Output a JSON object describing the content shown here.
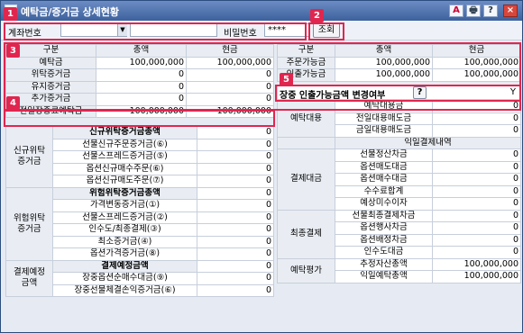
{
  "window": {
    "title": "예탁금/증거금 상세현황"
  },
  "title_buttons": [
    "A",
    "🖶",
    "?",
    "×"
  ],
  "toolbar": {
    "account_label": "계좌번호",
    "account_value": "",
    "account_name": "",
    "password_label": "비밀번호",
    "password_value": "****",
    "query_button": "조회"
  },
  "badges": [
    "1",
    "2",
    "3",
    "4",
    "5"
  ],
  "left_top": {
    "headers": [
      "구분",
      "총액",
      "현금"
    ],
    "rows": [
      {
        "label": "예탁금",
        "total": "100,000,000",
        "cash": "100,000,000"
      },
      {
        "label": "위탁증거금",
        "total": "0",
        "cash": "0"
      },
      {
        "label": "유지증거금",
        "total": "0",
        "cash": "0"
      },
      {
        "label": "추가증거금",
        "total": "0",
        "cash": "0"
      },
      {
        "label": "전일장종료예탁금",
        "total": "100,000,000",
        "cash": "100,000,000"
      }
    ]
  },
  "left_bottom": {
    "groups": [
      {
        "group": "신규위탁\n증거금",
        "header": "신규위탁증거금총액",
        "header_value": "0",
        "rows": [
          {
            "label": "선물신규주문증거금(⑥)",
            "value": "0"
          },
          {
            "label": "선물스프레드증거금(⑤)",
            "value": "0"
          },
          {
            "label": "옵션신규매수주문(⑥)",
            "value": "0"
          },
          {
            "label": "옵션신규매도주문(⑦)",
            "value": "0"
          }
        ]
      },
      {
        "group": "위험위탁\n증거금",
        "header": "위험위탁증거금총액",
        "header_value": "0",
        "rows": [
          {
            "label": "가격변동증거금(①)",
            "value": "0"
          },
          {
            "label": "선물스프레드증거금(②)",
            "value": "0"
          },
          {
            "label": "인수도/최종결제(③)",
            "value": "0"
          },
          {
            "label": "최소증거금(④)",
            "value": "0"
          },
          {
            "label": "옵션가격증거금(⑧)",
            "value": "0"
          }
        ]
      },
      {
        "group": "결제예정\n금액",
        "header": "결제예정금액",
        "header_value": "0",
        "rows": [
          {
            "label": "장중옵션순매수대금(⑨)",
            "value": "0"
          },
          {
            "label": "장중선물체결손익증거금(⑥)",
            "value": "0"
          }
        ]
      }
    ]
  },
  "right_top": {
    "headers": [
      "구분",
      "총액",
      "현금"
    ],
    "rows": [
      {
        "label": "주문가능금",
        "total": "100,000,000",
        "cash": "100,000,000"
      },
      {
        "label": "인출가능금",
        "total": "100,000,000",
        "cash": "100,000,000"
      }
    ],
    "change_label": "장중 인출가능금액 변경여부",
    "change_help": "?",
    "change_value": "Y"
  },
  "right_bottom": {
    "groups": [
      {
        "group": "예탁대용",
        "rows": [
          {
            "label": "예탁대용금",
            "value": "0"
          },
          {
            "label": "전일대용매도금",
            "value": "0"
          },
          {
            "label": "금일대용매도금",
            "value": "0"
          }
        ]
      }
    ],
    "settlement_header": "익일결제내역",
    "settlement_groups": [
      {
        "group": "결제대금",
        "rows": [
          {
            "label": "선물정산차금",
            "value": "0"
          },
          {
            "label": "옵션매도대금",
            "value": "0"
          },
          {
            "label": "옵션매수대금",
            "value": "0"
          },
          {
            "label": "수수료합계",
            "value": "0"
          },
          {
            "label": "예상미수이자",
            "value": "0"
          }
        ]
      },
      {
        "group": "최종결제",
        "rows": [
          {
            "label": "선물최종결제차금",
            "value": "0"
          },
          {
            "label": "옵션행사차금",
            "value": "0"
          },
          {
            "label": "옵션배정차금",
            "value": "0"
          },
          {
            "label": "인수도대금",
            "value": "0"
          }
        ]
      },
      {
        "group": "예탁평가",
        "rows": [
          {
            "label": "추정자산총액",
            "value": "100,000,000"
          },
          {
            "label": "익일예탁총액",
            "value": "100,000,000"
          }
        ]
      }
    ]
  }
}
